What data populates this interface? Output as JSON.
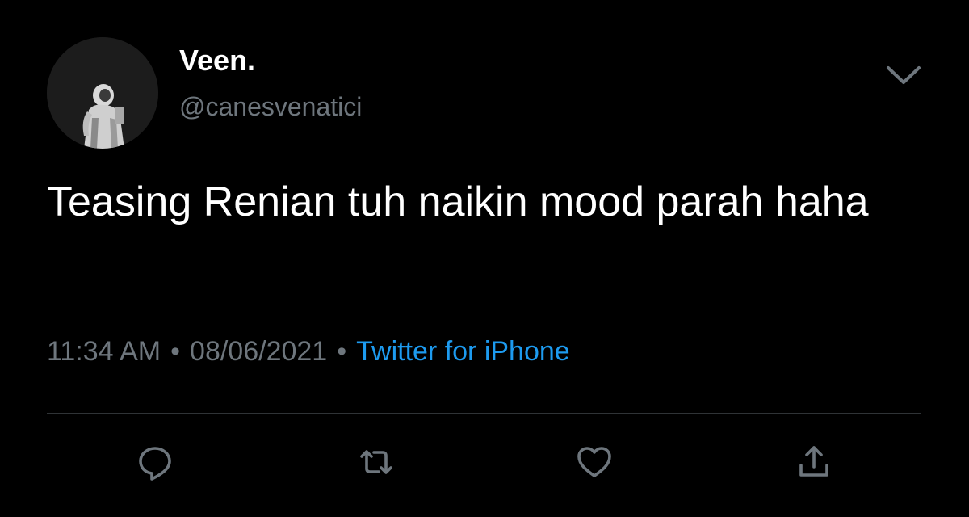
{
  "tweet": {
    "author": {
      "display_name": "Veen.",
      "handle": "@canesvenatici"
    },
    "text": "Teasing Renian tuh naikin mood parah haha",
    "time": "11:34 AM",
    "date": "08/06/2021",
    "separator": "•",
    "source": "Twitter for iPhone"
  },
  "colors": {
    "background": "#000000",
    "primary_text": "#ffffff",
    "secondary_text": "#6e767d",
    "link": "#1d9bf0",
    "divider": "#2f3336"
  },
  "actions": [
    {
      "icon": "reply-icon"
    },
    {
      "icon": "retweet-icon"
    },
    {
      "icon": "like-icon"
    },
    {
      "icon": "share-icon"
    }
  ],
  "menu": {
    "icon": "chevron-down-icon"
  }
}
